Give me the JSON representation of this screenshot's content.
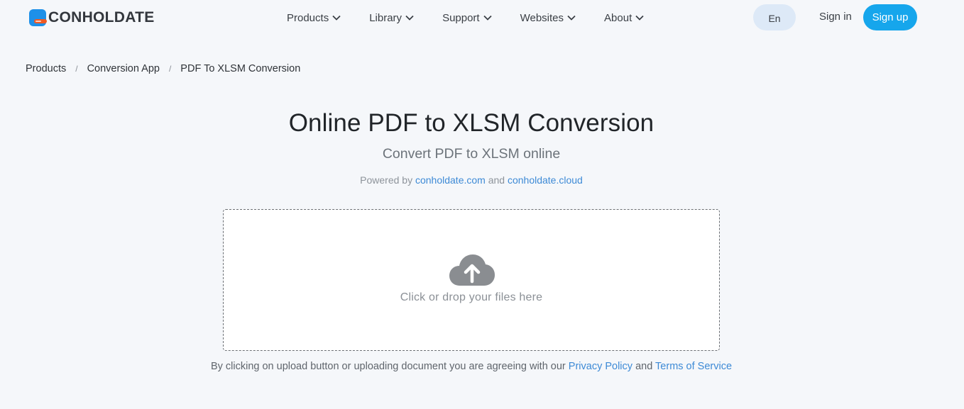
{
  "header": {
    "logo_text": "CONHOLDATE",
    "nav": [
      {
        "label": "Products"
      },
      {
        "label": "Library"
      },
      {
        "label": "Support"
      },
      {
        "label": "Websites"
      },
      {
        "label": "About"
      }
    ],
    "language": "En",
    "sign_in": "Sign in",
    "sign_up": "Sign up"
  },
  "breadcrumb": {
    "items": [
      {
        "label": "Products"
      },
      {
        "label": "Conversion App"
      },
      {
        "label": "PDF To XLSM Conversion"
      }
    ],
    "separator": "/"
  },
  "hero": {
    "title": "Online PDF to XLSM Conversion",
    "subtitle": "Convert PDF to XLSM online",
    "powered_prefix": "Powered by",
    "powered_link1": "conholdate.com",
    "powered_and": "and",
    "powered_link2": "conholdate.cloud"
  },
  "dropzone": {
    "icon": "cloud-upload-icon",
    "text": "Click or drop your files here"
  },
  "terms": {
    "prefix": "By clicking on upload button or uploading document you are agreeing with our",
    "privacy": "Privacy Policy",
    "and": "and",
    "tos": "Terms of Service"
  },
  "colors": {
    "accent": "#16a6ec",
    "link": "#3d8ad6",
    "background": "#f5f7fa",
    "lang_bg": "#dde9f7",
    "logo_blue": "#1e90e8",
    "logo_orange": "#ef5a24"
  }
}
